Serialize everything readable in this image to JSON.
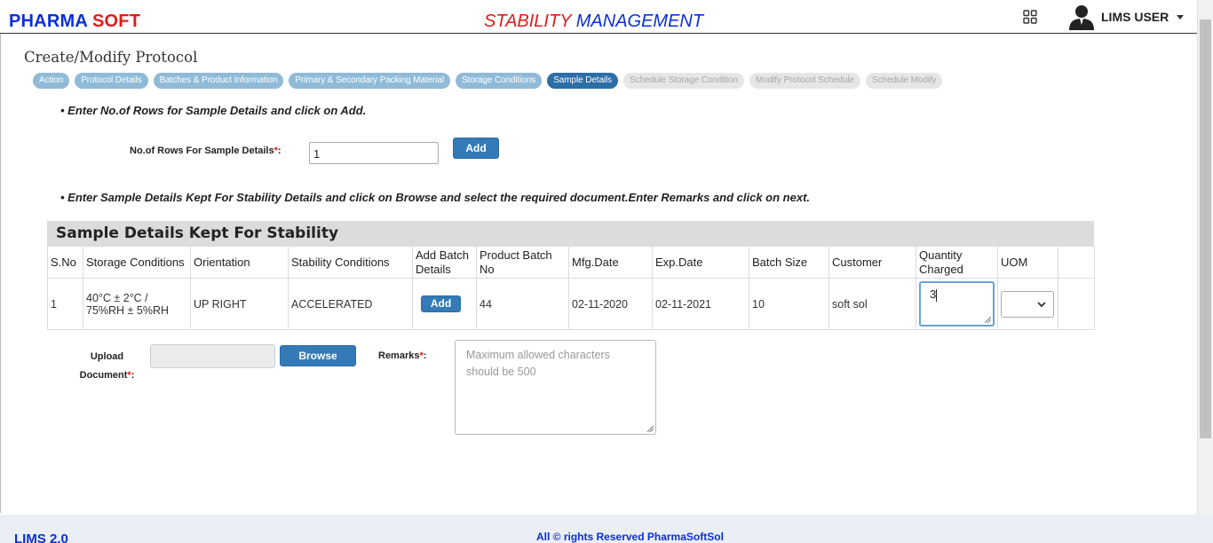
{
  "header": {
    "brand_part1": "PHARMA",
    "brand_part2": "SOFT",
    "title_part1": "STABILITY",
    "title_part2": "MANAGEMENT",
    "user_name": "LIMS USER"
  },
  "page_title": "Create/Modify Protocol",
  "tabs": [
    {
      "label": "Action",
      "state": "normal"
    },
    {
      "label": "Protocol Details",
      "state": "normal"
    },
    {
      "label": "Batches & Product Information",
      "state": "normal"
    },
    {
      "label": "Primary & Secondary Packing Material",
      "state": "normal"
    },
    {
      "label": "Storage Conditions",
      "state": "normal"
    },
    {
      "label": "Sample Details",
      "state": "active"
    },
    {
      "label": "Schedule Storage Condition",
      "state": "disabled"
    },
    {
      "label": "Modify Protocol Schedule",
      "state": "disabled"
    },
    {
      "label": "Schedule Modify",
      "state": "disabled"
    }
  ],
  "instructions": {
    "first": "• Enter No.of Rows for Sample Details and click on Add.",
    "second": "• Enter Sample Details Kept For Stability Details and click on Browse and select the required document.Enter Remarks and click on next."
  },
  "rows_form": {
    "label": "No.of Rows For Sample Details",
    "required_mark": "*",
    "colon": ":",
    "value": "1",
    "add_label": "Add"
  },
  "table": {
    "title": "Sample Details Kept For Stability",
    "headers": [
      "S.No",
      "Storage Conditions",
      "Orientation",
      "Stability Conditions",
      "Add Batch Details",
      "Product Batch No",
      "Mfg.Date",
      "Exp.Date",
      "Batch Size",
      "Customer",
      "Quantity Charged",
      "UOM",
      ""
    ],
    "row": {
      "sno": "1",
      "storage": "40°C ± 2°C / 75%RH ± 5%RH",
      "orientation": "UP RIGHT",
      "stability": "ACCELERATED",
      "add_batch_label": "Add",
      "product_batch_no": "44",
      "mfg_date": "02-11-2020",
      "exp_date": "02-11-2021",
      "batch_size": "10",
      "customer": "soft sol",
      "quantity": "3",
      "uom": ""
    }
  },
  "upload": {
    "label_line1": "Upload",
    "label_line2": "Document",
    "required_mark": "*",
    "colon": ":",
    "browse_label": "Browse"
  },
  "remarks": {
    "label": "Remarks",
    "required_mark": "*",
    "colon": ":",
    "placeholder": "Maximum allowed characters should be 500"
  },
  "footer": {
    "left": "LIMS 2.0",
    "center": "All © rights Reserved PharmaSoftSol"
  },
  "colors": {
    "brand_blue": "#0b2fd6",
    "brand_red": "#e11b1b",
    "tab_normal": "#8fbbd9",
    "tab_active": "#2b6ea8",
    "button": "#337ab7"
  }
}
